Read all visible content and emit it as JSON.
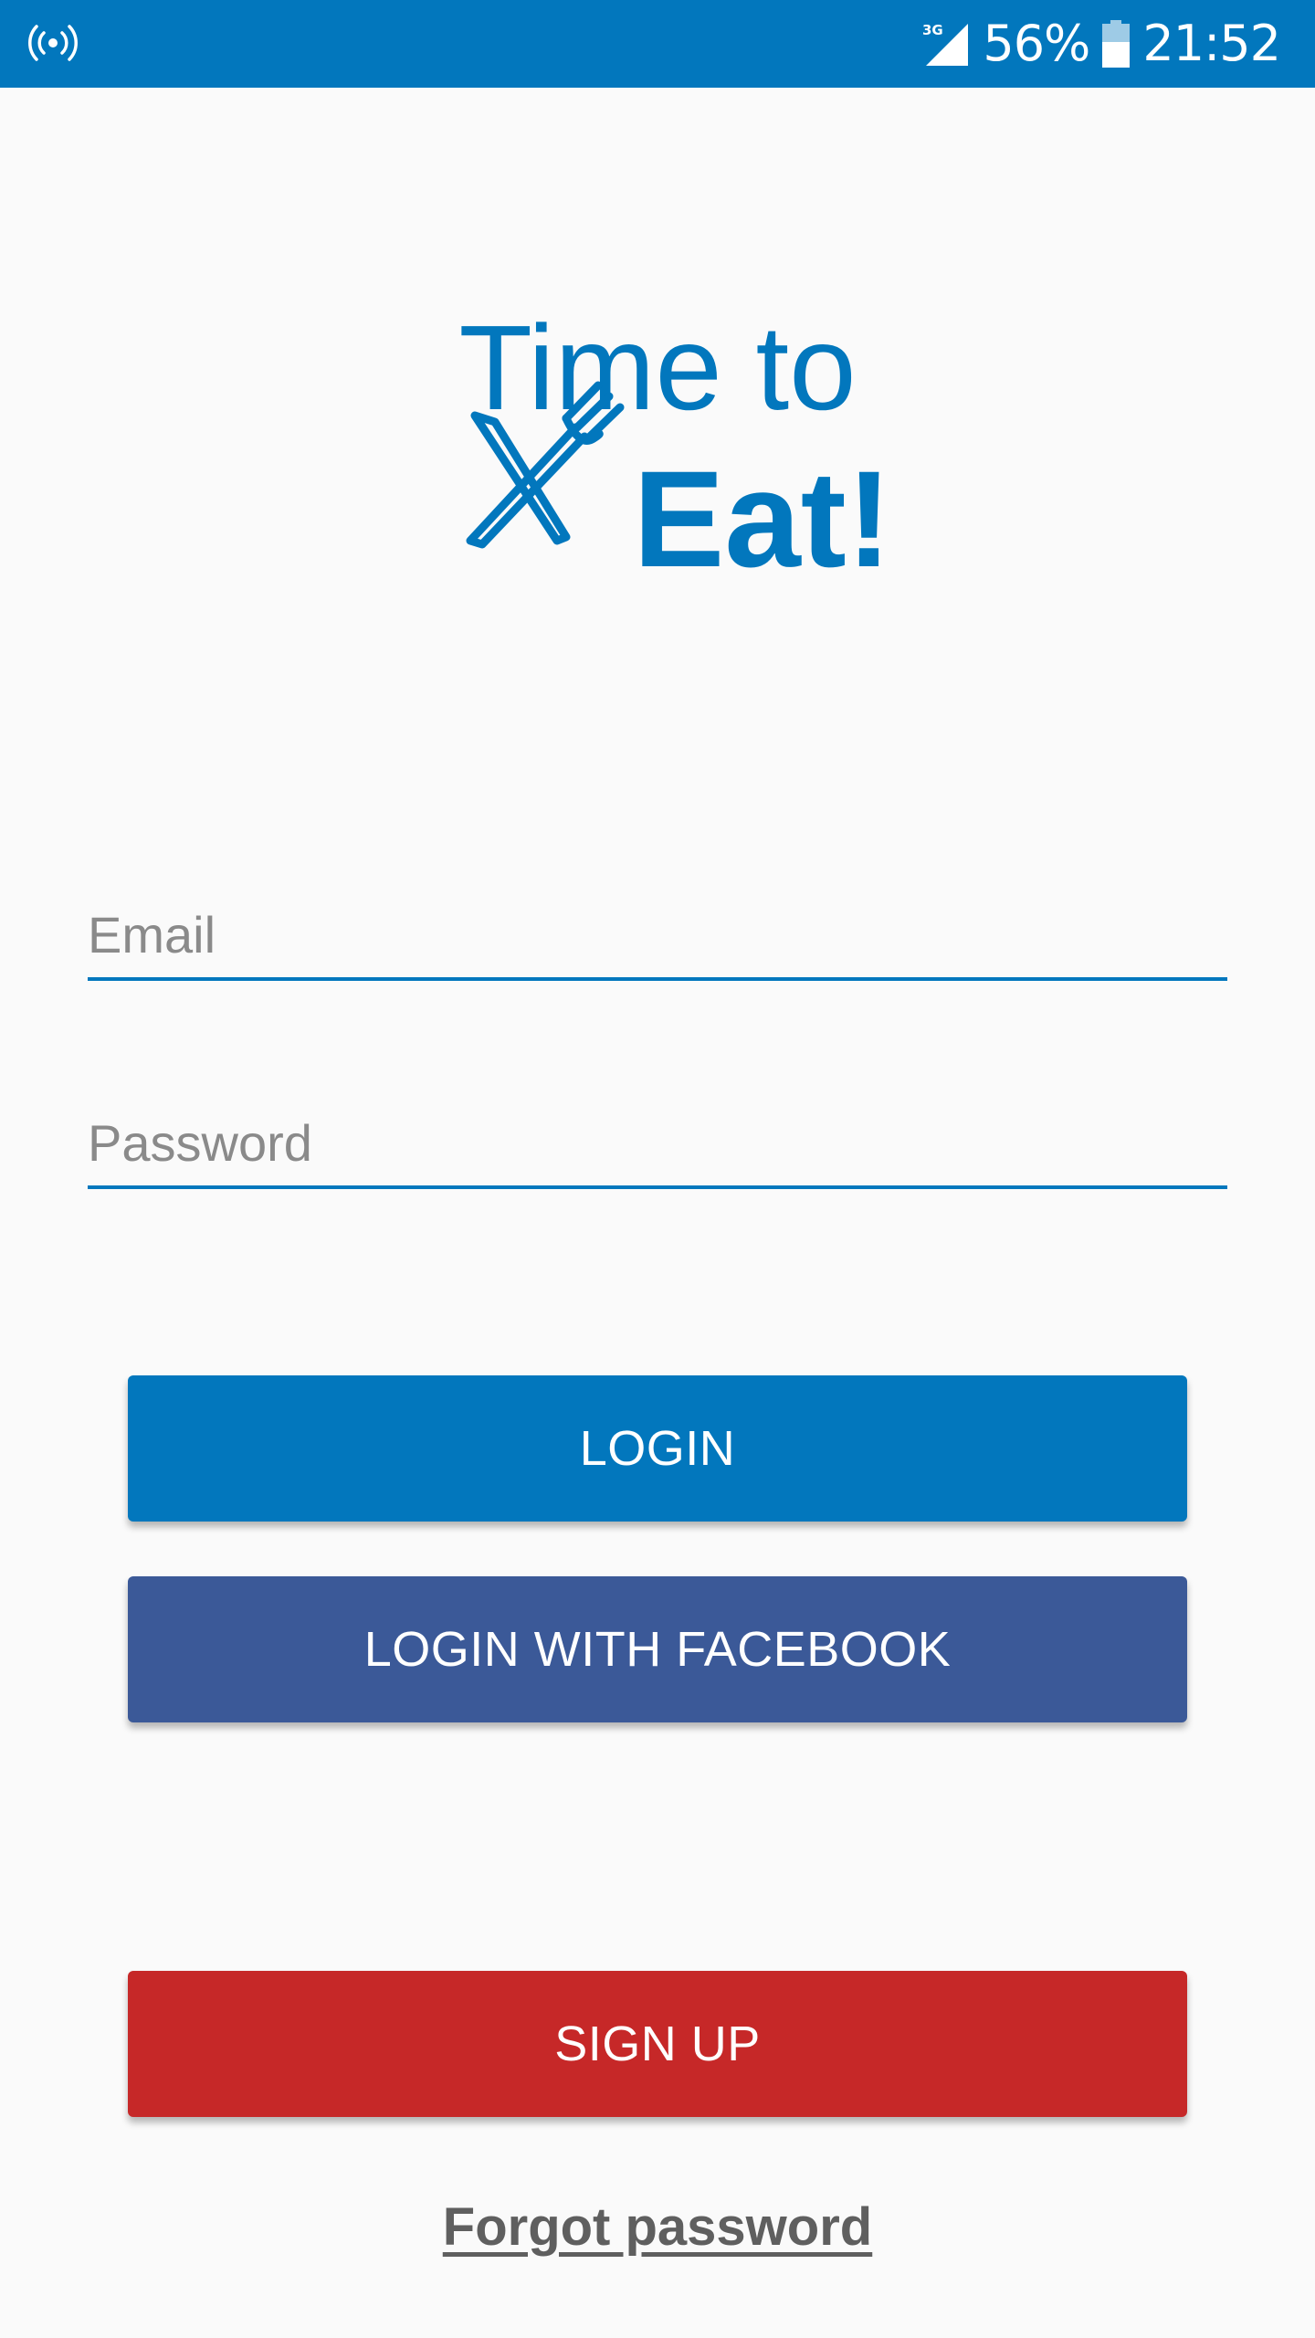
{
  "status_bar": {
    "network": "3G",
    "battery": "56%",
    "time": "21:52",
    "icons": [
      "hotspot-icon",
      "signal-icon",
      "battery-icon"
    ]
  },
  "logo": {
    "line1": "Time to",
    "line2": "Eat!",
    "icon": "fork-knife-icon",
    "color": "#0277bd"
  },
  "form": {
    "email_placeholder": "Email",
    "email_value": "",
    "password_placeholder": "Password",
    "password_value": ""
  },
  "buttons": {
    "login": "LOGIN",
    "facebook": "LOGIN WITH FACEBOOK",
    "signup": "SIGN UP",
    "forgot": "Forgot password"
  },
  "colors": {
    "primary": "#0277bd",
    "facebook": "#3b5998",
    "signup": "#c62828",
    "background": "#fafafa",
    "link": "#5f5f5f"
  }
}
